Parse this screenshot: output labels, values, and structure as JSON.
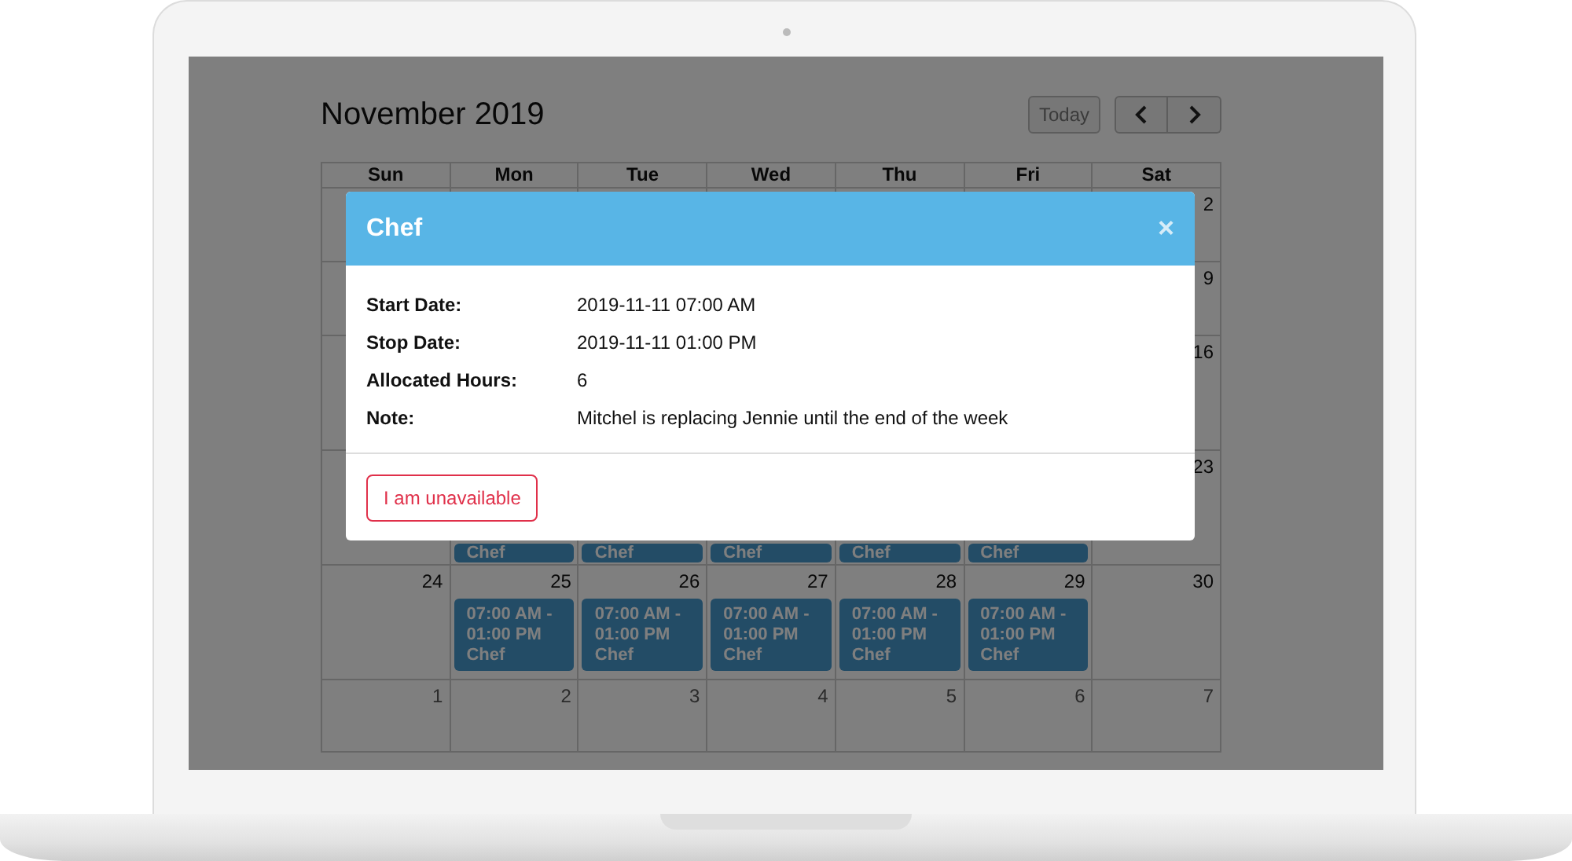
{
  "calendar": {
    "title": "November 2019",
    "today_button": "Today",
    "weekdays": [
      "Sun",
      "Mon",
      "Tue",
      "Wed",
      "Thu",
      "Fri",
      "Sat"
    ],
    "weeks": [
      {
        "days": [
          {
            "number": "2",
            "other_month": false
          }
        ]
      },
      {
        "days": [
          {
            "number": "9",
            "other_month": false
          }
        ]
      },
      {
        "days": [
          {
            "number": "16",
            "other_month": false
          }
        ]
      },
      {
        "days": [
          {
            "events": [
              {
                "title": "Chef"
              }
            ]
          },
          {
            "events": [
              {
                "title": "Chef"
              }
            ]
          },
          {
            "events": [
              {
                "title": "Chef"
              }
            ]
          },
          {
            "events": [
              {
                "title": "Chef"
              }
            ]
          },
          {
            "events": [
              {
                "title": "Chef"
              }
            ]
          },
          {
            "number": "23",
            "other_month": false
          }
        ]
      },
      {
        "days": [
          {
            "number": "24",
            "other_month": false
          },
          {
            "number": "25",
            "other_month": false,
            "events": [
              {
                "time": "07:00 AM - 01:00 PM",
                "title": "Chef"
              }
            ]
          },
          {
            "number": "26",
            "other_month": false,
            "events": [
              {
                "time": "07:00 AM - 01:00 PM",
                "title": "Chef"
              }
            ]
          },
          {
            "number": "27",
            "other_month": false,
            "events": [
              {
                "time": "07:00 AM - 01:00 PM",
                "title": "Chef"
              }
            ]
          },
          {
            "number": "28",
            "other_month": false,
            "events": [
              {
                "time": "07:00 AM - 01:00 PM",
                "title": "Chef"
              }
            ]
          },
          {
            "number": "29",
            "other_month": false,
            "events": [
              {
                "time": "07:00 AM - 01:00 PM",
                "title": "Chef"
              }
            ]
          },
          {
            "number": "30",
            "other_month": false
          }
        ]
      },
      {
        "days": [
          {
            "number": "1",
            "other_month": true
          },
          {
            "number": "2",
            "other_month": true
          },
          {
            "number": "3",
            "other_month": true
          },
          {
            "number": "4",
            "other_month": true
          },
          {
            "number": "5",
            "other_month": true
          },
          {
            "number": "6",
            "other_month": true
          },
          {
            "number": "7",
            "other_month": true
          }
        ]
      }
    ]
  },
  "modal": {
    "title": "Chef",
    "close": "×",
    "fields": [
      {
        "label": "Start Date:",
        "value": "2019-11-11 07:00 AM"
      },
      {
        "label": "Stop Date:",
        "value": "2019-11-11 01:00 PM"
      },
      {
        "label": "Allocated Hours:",
        "value": "6"
      },
      {
        "label": "Note:",
        "value": "Mitchel is replacing Jennie until the end of the week"
      }
    ],
    "action_button": "I am unavailable"
  }
}
